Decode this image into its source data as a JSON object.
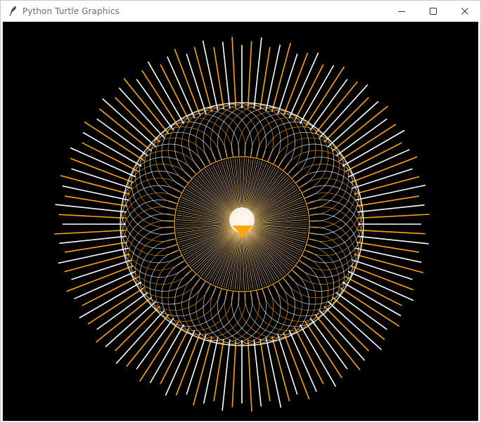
{
  "window": {
    "title": "Python Turtle Graphics",
    "icon": "feather-icon",
    "controls": [
      "minimize-icon",
      "maximize-icon",
      "close-icon"
    ]
  },
  "canvas": {
    "background": "#000000"
  },
  "drawing": {
    "colors": [
      "#ffffff",
      "#ffa500"
    ],
    "icons": [
      "turtle-icon"
    ]
  }
}
